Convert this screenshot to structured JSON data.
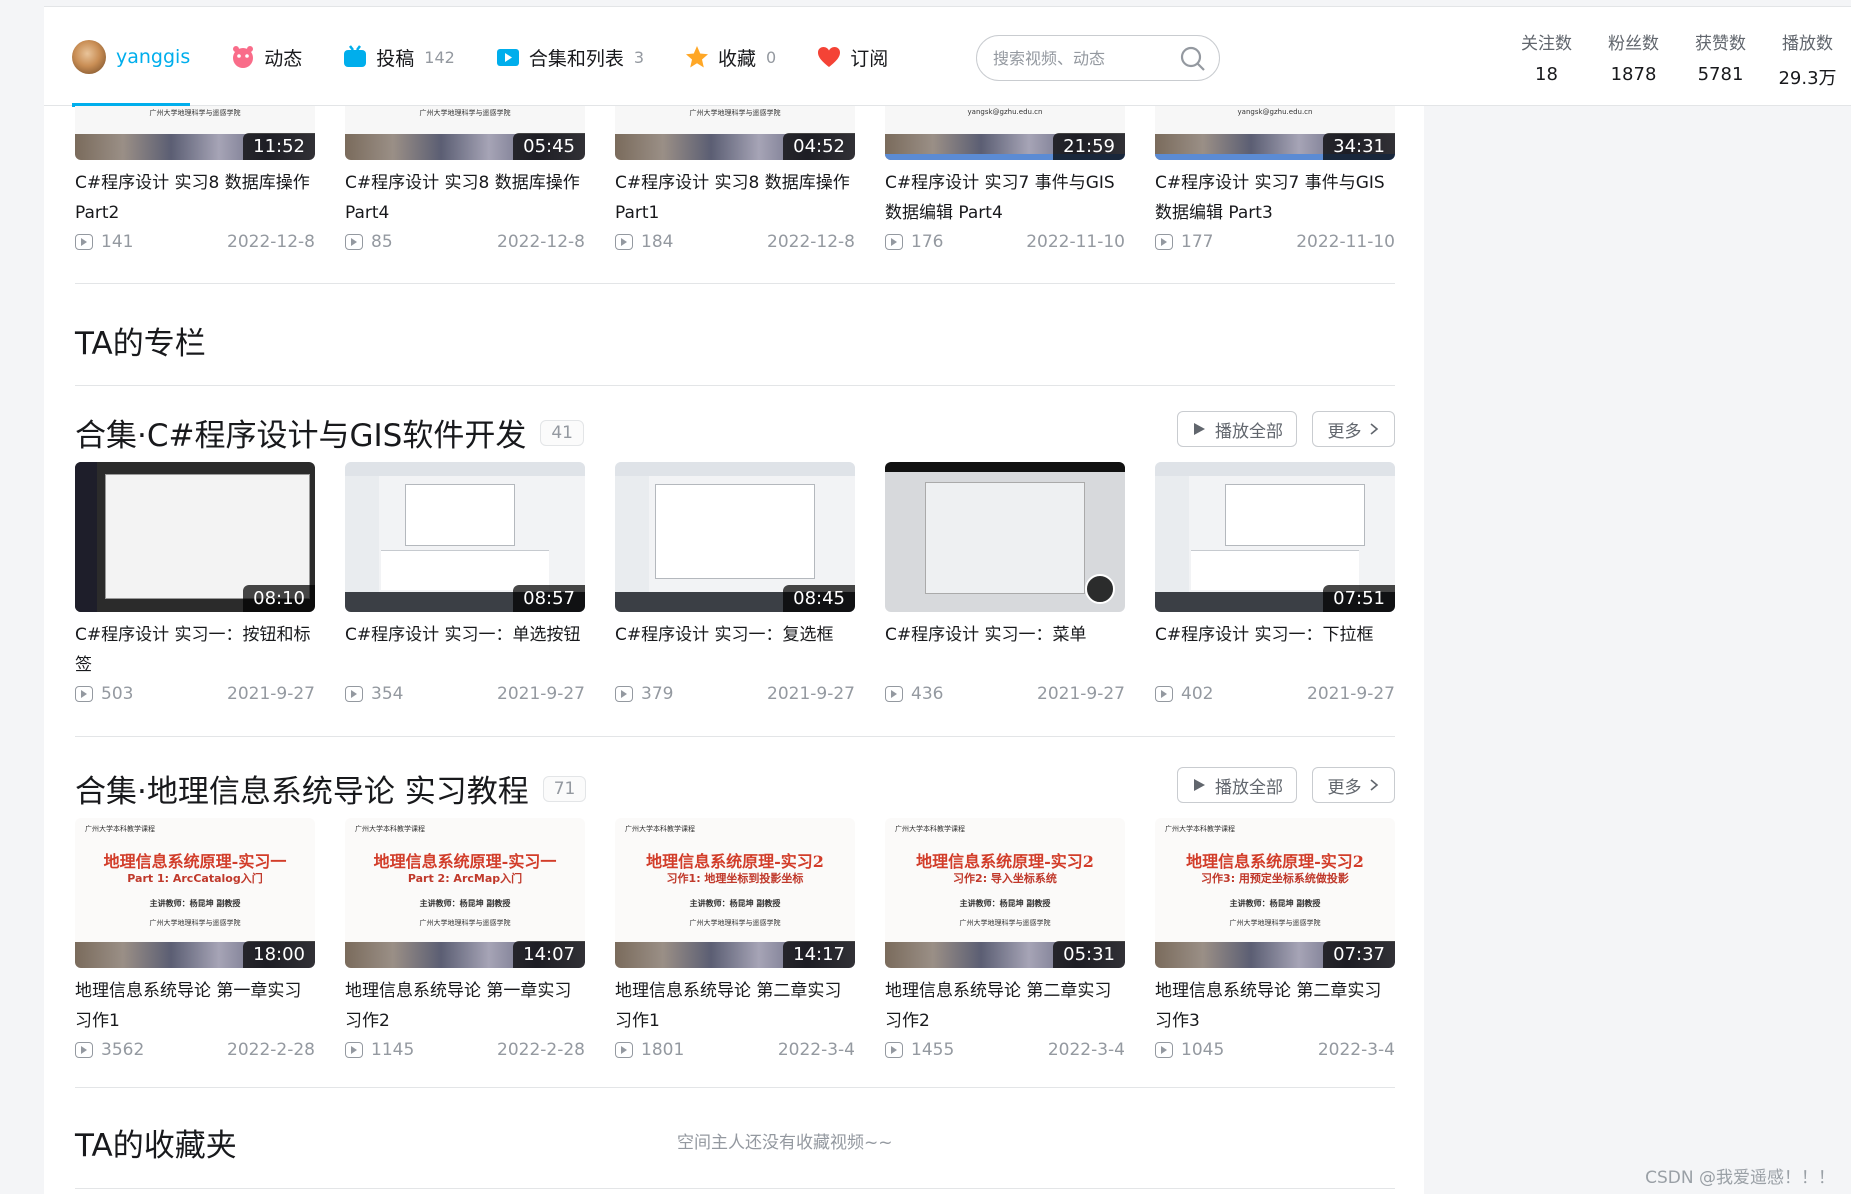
{
  "nav": {
    "username": "yanggis",
    "tabs": [
      {
        "label": "动态",
        "count": ""
      },
      {
        "label": "投稿",
        "count": "142"
      },
      {
        "label": "合集和列表",
        "count": "3"
      },
      {
        "label": "收藏",
        "count": "0"
      },
      {
        "label": "订阅",
        "count": ""
      }
    ],
    "search_placeholder": "搜索视频、动态",
    "stats": [
      {
        "label": "关注数",
        "value": "18"
      },
      {
        "label": "粉丝数",
        "value": "1878"
      },
      {
        "label": "获赞数",
        "value": "5781"
      },
      {
        "label": "播放数",
        "value": "29.3万"
      }
    ]
  },
  "top_videos": [
    {
      "duration": "11:52",
      "title": "C#程序设计 实习8 数据库操作 Part2",
      "plays": "141",
      "date": "2022-12-8"
    },
    {
      "duration": "05:45",
      "title": "C#程序设计 实习8 数据库操作 Part4",
      "plays": "85",
      "date": "2022-12-8"
    },
    {
      "duration": "04:52",
      "title": "C#程序设计 实习8 数据库操作 Part1",
      "plays": "184",
      "date": "2022-12-8"
    },
    {
      "duration": "21:59",
      "title": "C#程序设计 实习7 事件与GIS数据编辑 Part4",
      "plays": "176",
      "date": "2022-11-10"
    },
    {
      "duration": "34:31",
      "title": "C#程序设计 实习7 事件与GIS数据编辑 Part3",
      "plays": "177",
      "date": "2022-11-10"
    }
  ],
  "column_section": {
    "title": "TA的专栏"
  },
  "collection1": {
    "title": "合集·C#程序设计与GIS软件开发",
    "count": "41",
    "play_all": "播放全部",
    "more": "更多",
    "videos": [
      {
        "duration": "08:10",
        "title": "C#程序设计 实习一：按钮和标签",
        "plays": "503",
        "date": "2021-9-27"
      },
      {
        "duration": "08:57",
        "title": "C#程序设计 实习一：单选按钮",
        "plays": "354",
        "date": "2021-9-27"
      },
      {
        "duration": "08:45",
        "title": "C#程序设计 实习一：复选框",
        "plays": "379",
        "date": "2021-9-27"
      },
      {
        "duration": "",
        "title": "C#程序设计 实习一：菜单",
        "plays": "436",
        "date": "2021-9-27"
      },
      {
        "duration": "07:51",
        "title": "C#程序设计 实习一：下拉框",
        "plays": "402",
        "date": "2021-9-27"
      }
    ]
  },
  "collection2": {
    "title": "合集·地理信息系统导论 实习教程",
    "count": "71",
    "play_all": "播放全部",
    "more": "更多",
    "videos": [
      {
        "duration": "18:00",
        "title": "地理信息系统导论 第一章实习习作1",
        "plays": "3562",
        "date": "2022-2-28",
        "slide_title": "地理信息系统原理-实习一",
        "slide_sub": "Part 1: ArcCatalog入门"
      },
      {
        "duration": "14:07",
        "title": "地理信息系统导论 第一章实习习作2",
        "plays": "1145",
        "date": "2022-2-28",
        "slide_title": "地理信息系统原理-实习一",
        "slide_sub": "Part 2: ArcMap入门"
      },
      {
        "duration": "14:17",
        "title": "地理信息系统导论 第二章实习习作1",
        "plays": "1801",
        "date": "2022-3-4",
        "slide_title": "地理信息系统原理-实习2",
        "slide_sub": "习作1: 地理坐标到投影坐标"
      },
      {
        "duration": "05:31",
        "title": "地理信息系统导论 第二章实习习作2",
        "plays": "1455",
        "date": "2022-3-4",
        "slide_title": "地理信息系统原理-实习2",
        "slide_sub": "习作2: 导入坐标系统"
      },
      {
        "duration": "07:37",
        "title": "地理信息系统导论 第二章实习习作3",
        "plays": "1045",
        "date": "2022-3-4",
        "slide_title": "地理信息系统原理-实习2",
        "slide_sub": "习作3: 用预定坐标系统做投影"
      }
    ],
    "slide_header": "广州大学本科教学课程",
    "slide_teacher": "主讲教师：杨昆坤 副教授",
    "slide_uni": "广州大学地理科学与遥感学院"
  },
  "favorites_section": {
    "title": "TA的收藏夹",
    "empty_text": "空间主人还没有收藏视频~~"
  },
  "watermark": "CSDN @我爱遥感！！！",
  "colors": {
    "accent": "#00aeec",
    "text": "#18191c",
    "muted": "#9499a0"
  }
}
